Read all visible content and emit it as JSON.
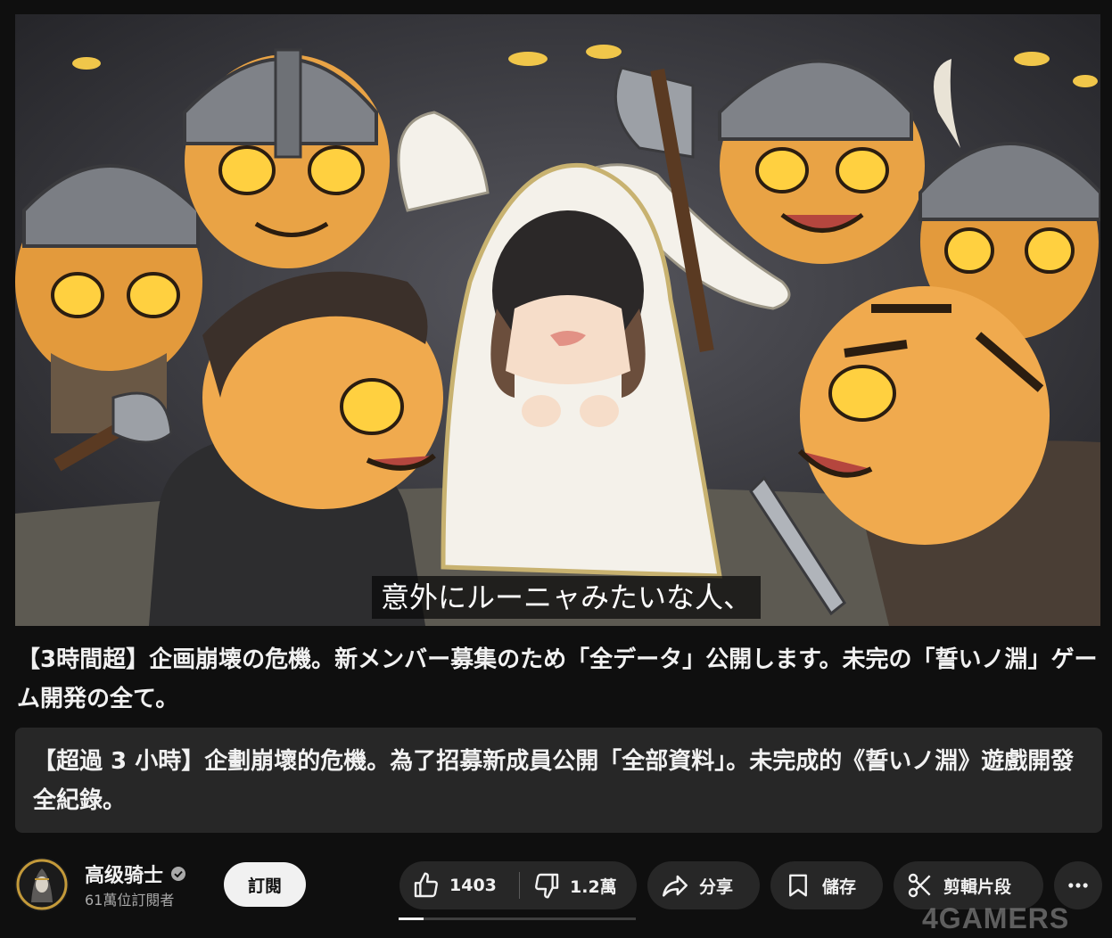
{
  "video": {
    "subtitle": "意外にルーニャみたいな人、"
  },
  "title": "【3時間超】企画崩壊の危機。新メンバー募集のため「全データ」公開します。未完の「誓いノ淵」ゲーム開発の全て。",
  "translation": "【超過 3 小時】企劃崩壞的危機。為了招募新成員公開「全部資料」。未完成的《誓いノ淵》遊戲開發全紀錄。",
  "channel": {
    "name": "高级骑士",
    "subscribers": "61萬位訂閱者",
    "subscribe_label": "訂閱"
  },
  "actions": {
    "like_count": "1403",
    "dislike_count": "1.2萬",
    "share_label": "分享",
    "save_label": "儲存",
    "clip_label": "剪輯片段"
  },
  "watermark": "4GAMERS",
  "colors": {
    "background": "#0f0f0f",
    "pill": "#272727",
    "subscribe_button": "#f1f1f1",
    "secondary_text": "#aaaaaa"
  },
  "icons": [
    "like-icon",
    "dislike-icon",
    "share-icon",
    "save-icon",
    "clip-icon",
    "more-icon",
    "verified-icon"
  ]
}
